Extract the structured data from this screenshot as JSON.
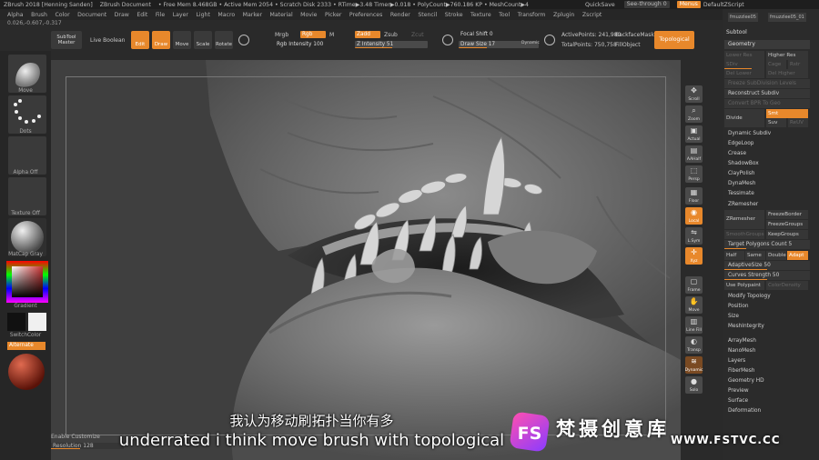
{
  "titlebar": {
    "app_title": "ZBrush 2018 [Henning Sanden]",
    "doc_label": "ZBrush Document",
    "stats": "• Free Mem 8.468GB • Active Mem 2054 • Scratch Disk 2333 • RTime▶3.48 Timer▶0.018 • PolyCount▶760.186 KP • MeshCount▶4",
    "quicksave": "QuickSave",
    "seethrough": "See-through 0",
    "menus": "Menus",
    "defaultzscript": "DefaultZScript"
  },
  "menubar": [
    "Alpha",
    "Brush",
    "Color",
    "Document",
    "Draw",
    "Edit",
    "File",
    "Layer",
    "Light",
    "Macro",
    "Marker",
    "Material",
    "Movie",
    "Picker",
    "Preferences",
    "Render",
    "Stencil",
    "Stroke",
    "Texture",
    "Tool",
    "Transform",
    "Zplugin",
    "Zscript"
  ],
  "statusline": "0.026,-0.607,-0.317",
  "toolbar": {
    "subtool_master": "SubTool Master",
    "live_boolean": "Live Boolean",
    "edit": "Edit",
    "draw": "Draw",
    "move": "Move",
    "scale": "Scale",
    "rotate": "Rotate",
    "mrgb": "Mrgb",
    "rgb": "Rgb",
    "m": "M",
    "zadd": "Zadd",
    "zsub": "Zsub",
    "zcut": "Zcut",
    "rgb_intensity": "Rgb Intensity 100",
    "z_intensity": "Z Intensity 51",
    "focal_shift": "Focal Shift 0",
    "draw_size": "Draw Size 17",
    "dynamic": "Dynamic",
    "active_points": "ActivePoints: 241,980",
    "total_points": "TotalPoints: 750,758",
    "backface_mask": "BackfaceMask",
    "fill_object": "FillObject",
    "topological": "Topological"
  },
  "lefttray": {
    "brush": "Move",
    "stroke": "Dots",
    "alpha": "Alpha Off",
    "texture": "Texture Off",
    "material": "MatCap Gray",
    "gradient": "Gradient",
    "switchcolor": "SwitchColor",
    "alternate": "Alternate",
    "colors": {
      "accent": "#e8882b",
      "material": "#b03a2a"
    }
  },
  "rightshelf": [
    {
      "label": "Scroll",
      "glyph": "✥"
    },
    {
      "label": "Zoom",
      "glyph": "⌕"
    },
    {
      "label": "Actual",
      "glyph": "▣"
    },
    {
      "label": "AAHalf",
      "glyph": "▤"
    },
    {
      "label": "Persp",
      "glyph": "⬚"
    },
    {
      "label": "Floor",
      "glyph": "▦"
    },
    {
      "label": "Local",
      "glyph": "◉"
    },
    {
      "label": "L.Sym",
      "glyph": "⇋"
    },
    {
      "label": "Xyz",
      "glyph": "✛"
    },
    {
      "label": "Frame",
      "glyph": "▢"
    },
    {
      "label": "Move",
      "glyph": "✋"
    },
    {
      "label": "Line Fill",
      "glyph": "▥"
    },
    {
      "label": "Transp",
      "glyph": "◐"
    },
    {
      "label": "Dynamic",
      "glyph": "≋"
    },
    {
      "label": "Solo",
      "glyph": "●"
    }
  ],
  "rightpanel": {
    "subtool_names": [
      "fmuzzlee05",
      "fmuzzlee05_01"
    ],
    "subtool": "Subtool",
    "geometry": "Geometry",
    "lower_res": "Lower Res",
    "higher_res": "Higher Res",
    "sdiv": "SDiv",
    "cage": "Cage",
    "rstr": "Rstr",
    "del_lower": "Del Lower",
    "del_higher": "Del Higher",
    "freeze_subdiv": "Freeze SubDivision Levels",
    "reconstruct_subdiv": "Reconstruct Subdiv",
    "convert_bpr": "Convert BPR To Geo",
    "divide": "Divide",
    "smt": "Smt",
    "suv": "Suv",
    "reuv": "ReUV",
    "dynamic_subdiv": "Dynamic Subdiv",
    "edgeloop": "EdgeLoop",
    "crease": "Crease",
    "shadowbox": "ShadowBox",
    "claypolish": "ClayPolish",
    "dynamesh": "DynaMesh",
    "tessimate": "Tessimate",
    "zremesher_header": "ZRemesher",
    "zremesher_btn": "ZRemesher",
    "freeze_border": "FreezeBorder",
    "freeze_groups": "FreezeGroups",
    "smooth_groups": "SmoothGroups",
    "keep_groups": "KeepGroups",
    "target_polygons": "Target Polygons Count 5",
    "half": "Half",
    "same": "Same",
    "double": "Double",
    "adapt": "Adapt",
    "adaptive_size": "AdaptiveSize 50",
    "curves_strength": "Curves Strength 50",
    "use_polypaint": "Use Polypaint",
    "color_density": "ColorDensity",
    "modify_topology": "Modify Topology",
    "position": "Position",
    "size": "Size",
    "mesh_integrity": "MeshIntegrity",
    "submenus": [
      "ArrayMesh",
      "NanoMesh",
      "Layers",
      "FiberMesh",
      "Geometry HD",
      "Preview",
      "Surface",
      "Deformation"
    ]
  },
  "bottom": {
    "enable_customize": "Enable Customize",
    "resolution": "Resolution 128"
  },
  "subtitles": {
    "cn": "我认为移动刷拓扑当你有多",
    "en": "underrated i think move brush with topological"
  },
  "watermark": {
    "logo_letters": "FS",
    "brand_cn": "梵摄创意库",
    "url": "WWW.FSTVC.CC"
  }
}
